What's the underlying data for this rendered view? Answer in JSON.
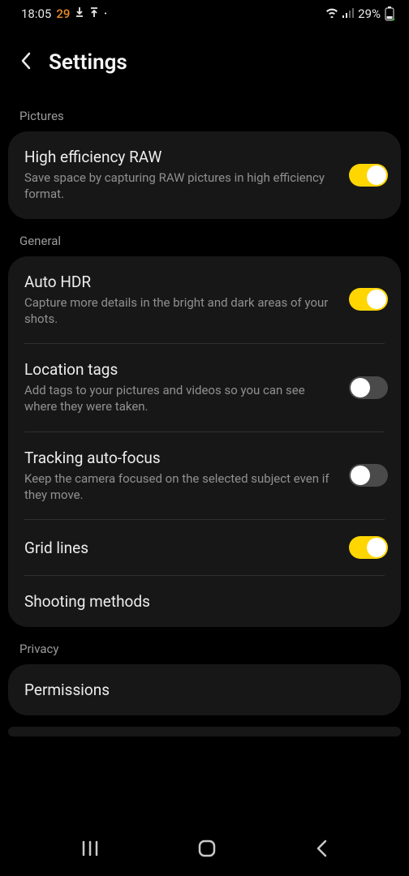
{
  "status_bar": {
    "time": "18:05",
    "notif_count": "29",
    "battery_pct": "29%"
  },
  "header": {
    "title": "Settings"
  },
  "sections": {
    "pictures": {
      "label": "Pictures",
      "high_eff_raw": {
        "title": "High efficiency RAW",
        "desc": "Save space by capturing RAW pictures in high efficiency format.",
        "on": true
      }
    },
    "general": {
      "label": "General",
      "auto_hdr": {
        "title": "Auto HDR",
        "desc": "Capture more details in the bright and dark areas of your shots.",
        "on": true
      },
      "location_tags": {
        "title": "Location tags",
        "desc": "Add tags to your pictures and videos so you can see where they were taken.",
        "on": false
      },
      "tracking_af": {
        "title": "Tracking auto-focus",
        "desc": "Keep the camera focused on the selected subject even if they move.",
        "on": false
      },
      "grid_lines": {
        "title": "Grid lines",
        "on": true
      },
      "shooting_methods": {
        "title": "Shooting methods"
      }
    },
    "privacy": {
      "label": "Privacy",
      "permissions": {
        "title": "Permissions"
      }
    }
  }
}
